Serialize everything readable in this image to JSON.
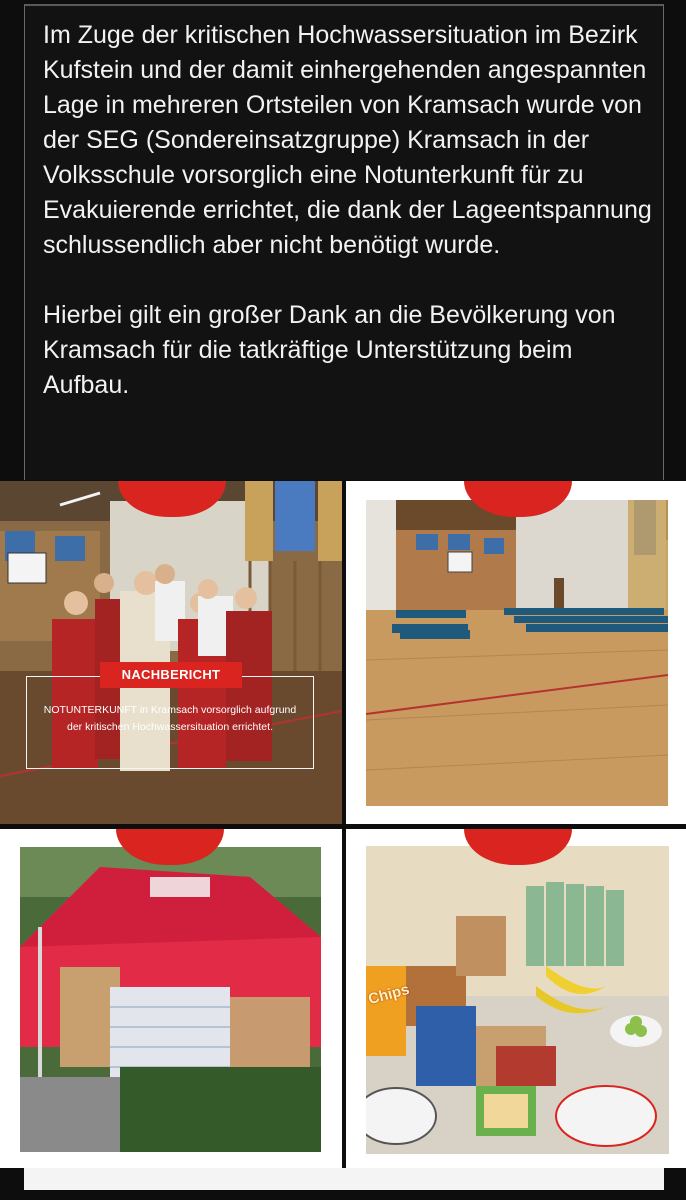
{
  "post": {
    "paragraph_1": "Im Zuge der kritischen Hochwassersituation im Bezirk Kufstein und der damit einhergehenden angespannten Lage in mehreren Ortsteilen von Kramsach wurde von der SEG (Sondereinsatzgruppe) Kramsach in der Volksschule vorsorglich eine Notunterkunft für zu Evakuierende errichtet, die dank der Lageentspannung schlussendlich aber nicht benötigt wurde.",
    "paragraph_2": "Hierbei gilt ein großer Dank an die Bevölkerung von Kramsach für die tatkräftige Unterstützung beim Aufbau."
  },
  "images": {
    "image_1": {
      "label": "NACHBERICHT",
      "caption": "NOTUNTERKUNFT in Kramsach vorsorglich aufgrund der kritischen Hochwassersituation errichtet."
    },
    "image_4": {
      "chips_label": "Chips"
    }
  },
  "colors": {
    "accent": "#d9241f",
    "background": "#0d0d0d",
    "text": "#f2f2f2"
  }
}
